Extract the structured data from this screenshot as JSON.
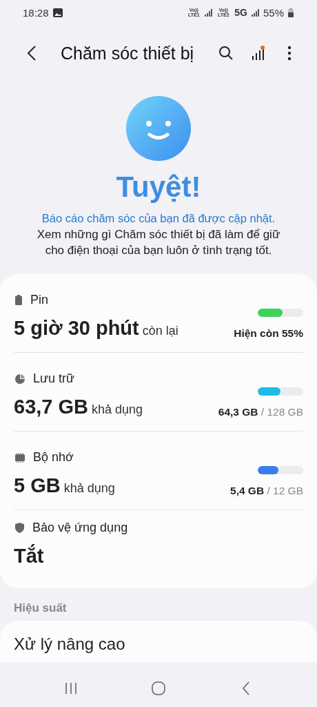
{
  "status_bar": {
    "time": "18:28",
    "sim1": "Vo)) LTE1",
    "sim2": "Vo)) LTE2",
    "network": "5G",
    "battery": "55%"
  },
  "header": {
    "title": "Chăm sóc thiết bị",
    "has_notification": true
  },
  "hero": {
    "headline": "Tuyệt!",
    "link": "Báo cáo chăm sóc của bạn đã được cập nhật.",
    "description": "Xem những gì Chăm sóc thiết bị đã làm để giữ cho điện thoại của bạn luôn ở tình trạng tốt."
  },
  "status_items": [
    {
      "kind": "battery",
      "label": "Pin",
      "value": "5 giờ 30 phút",
      "suffix": "còn lại",
      "level": 0.55,
      "color": "#3dd35a",
      "reading": "Hiện còn 55%"
    },
    {
      "kind": "storage",
      "label": "Lưu trữ",
      "value": "63,7 GB",
      "suffix": "khả dụng",
      "level": 0.5,
      "color": "#1fbbe0",
      "reading": "64,3 GB",
      "reading_total": "/ 128 GB"
    },
    {
      "kind": "memory",
      "label": "Bộ nhớ",
      "value": "5 GB",
      "suffix": "khả dụng",
      "level": 0.45,
      "color": "#3a7ef0",
      "reading": "5,4 GB",
      "reading_total": "/ 12 GB"
    },
    {
      "kind": "security",
      "label": "Bảo vệ ứng dụng",
      "value": "Tắt"
    }
  ],
  "section": {
    "title": "Hiệu suất",
    "item": "Xử lý nâng cao"
  }
}
